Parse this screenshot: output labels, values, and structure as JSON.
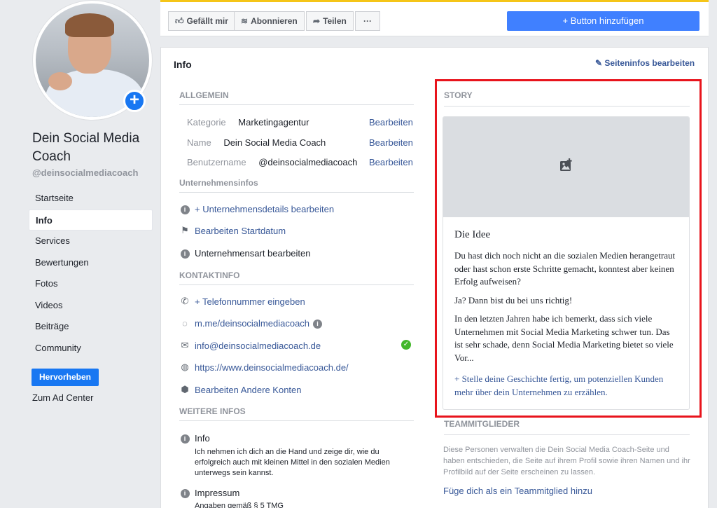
{
  "profile": {
    "name": "Dein Social Media Coach",
    "handle": "@deinsocialmediacoach"
  },
  "nav": {
    "items": [
      "Startseite",
      "Info",
      "Services",
      "Bewertungen",
      "Fotos",
      "Videos",
      "Beiträge",
      "Community"
    ],
    "active": "Info",
    "promote_label": "Hervorheben",
    "ad_center_label": "Zum Ad Center"
  },
  "toolbar": {
    "like_label": "Gefällt mir",
    "follow_label": "Abonnieren",
    "share_label": "Teilen",
    "more_label": "···",
    "add_button_label": "+ Button hinzufügen"
  },
  "info": {
    "title": "Info",
    "edit_page_info": "Seiteninfos bearbeiten",
    "general": {
      "heading": "ALLGEMEIN",
      "category_label": "Kategorie",
      "category_value": "Marketingagentur",
      "name_label": "Name",
      "name_value": "Dein Social Media Coach",
      "username_label": "Benutzername",
      "username_value": "@deinsocialmediacoach",
      "edit_label": "Bearbeiten"
    },
    "business": {
      "heading": "Unternehmensinfos",
      "details_link": "+ Unternehmensdetails bearbeiten",
      "start_date_link": "Bearbeiten Startdatum",
      "business_type": "Unternehmensart bearbeiten"
    },
    "contact": {
      "heading": "KONTAKTINFO",
      "phone_link": "+ Telefonnummer eingeben",
      "messenger": "m.me/deinsocialmediacoach",
      "email": "info@deinsocialmediacoach.de",
      "website": "https://www.deinsocialmediacoach.de/",
      "other_accounts": "Bearbeiten Andere Konten"
    },
    "more": {
      "heading": "WEITERE INFOS",
      "info_label": "Info",
      "info_text": "Ich nehmen ich dich an die Hand und zeige dir, wie du erfolgreich auch mit kleinen Mittel in den sozialen Medien unterwegs sein kannst.",
      "impressum_label": "Impressum",
      "impressum_text": "Angaben gemäß § 5 TMG"
    }
  },
  "story": {
    "heading": "STORY",
    "title": "Die Idee",
    "p1": "Du hast dich noch nicht an die sozialen Medien herangetraut oder hast schon erste Schritte gemacht, konntest aber keinen Erfolg aufweisen?",
    "p2": "Ja? Dann bist du bei uns richtig!",
    "p3": "In den letzten Jahren habe ich bemerkt, dass sich viele Unternehmen mit Social Media Marketing schwer tun. Das ist sehr schade, denn Social Media Marketing bietet so viele Vor...",
    "more_link": "+ Stelle deine Geschichte fertig, um potenziellen Kunden mehr über dein Unternehmen zu erzählen."
  },
  "team": {
    "heading": "TEAMMITGLIEDER",
    "description": "Diese Personen verwalten die Dein Social Media Coach-Seite und haben entschieden, die Seite auf ihrem Profil sowie ihren Namen und ihr Profilbild auf der Seite erscheinen zu lassen.",
    "join_link": "Füge dich als ein Teammitglied hinzu"
  },
  "colors": {
    "accent": "#1877f2",
    "link": "#385898",
    "highlight_frame": "#e8141c",
    "top_stripe": "#f5c518"
  },
  "icons": [
    "plus-icon",
    "thumbs-up-icon",
    "rss-icon",
    "share-icon",
    "info-icon",
    "flag-icon",
    "phone-icon",
    "messenger-icon",
    "mail-icon",
    "globe-icon",
    "cube-icon",
    "verified-check-icon",
    "add-image-icon",
    "pencil-icon"
  ]
}
